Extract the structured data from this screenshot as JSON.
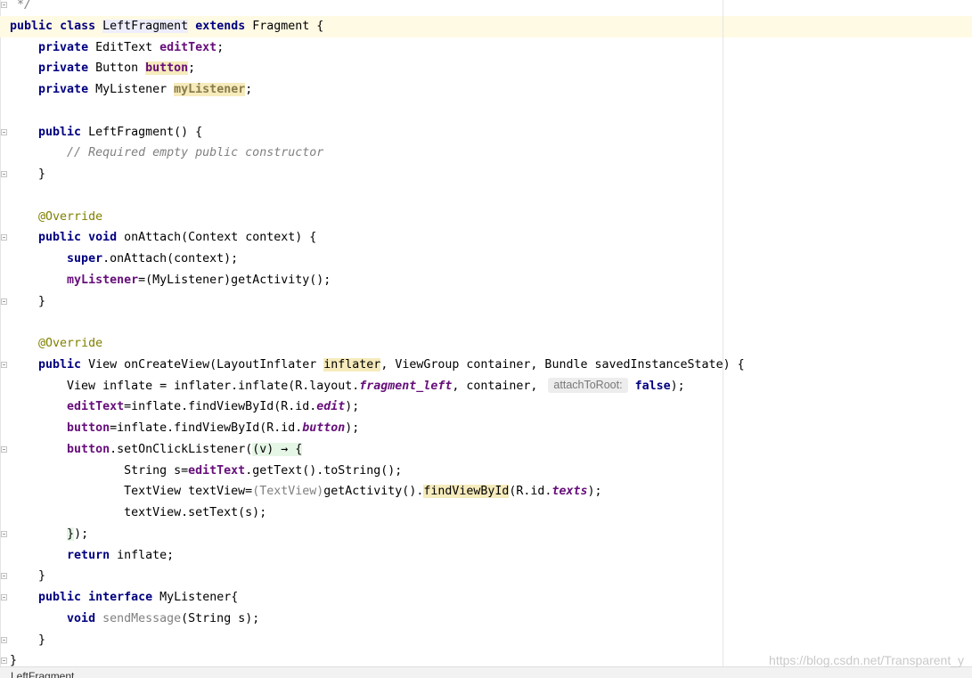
{
  "theme": {
    "keyword": "#000080",
    "field": "#660E7A",
    "unused_field": "#8A7B4A",
    "comment": "#808080",
    "annotation": "#808000",
    "unused": "#808080",
    "hint_text": "#787878",
    "hint_bg": "#EDEDED",
    "usage_bg": "#F6EBBC",
    "lambda_bg": "#E6F6E6",
    "ident_bg": "#EDEDFC",
    "current_line_bg": "#FFFAE3"
  },
  "editor": {
    "current_line": 1,
    "lines": [
      {
        "fold": "close",
        "tokens": [
          {
            "t": " */",
            "k": "cmt"
          }
        ]
      },
      {
        "tokens": [
          {
            "t": "public",
            "k": "kw"
          },
          {
            "t": " "
          },
          {
            "t": "class",
            "k": "kw"
          },
          {
            "t": " "
          },
          {
            "t": "LeftFragment",
            "bg": "ident"
          },
          {
            "t": " "
          },
          {
            "t": "extends",
            "k": "kw"
          },
          {
            "t": " Fragment {"
          }
        ]
      },
      {
        "tokens": [
          {
            "t": "    "
          },
          {
            "t": "private",
            "k": "kw"
          },
          {
            "t": " EditText "
          },
          {
            "t": "editText",
            "k": "fld"
          },
          {
            "t": ";"
          }
        ]
      },
      {
        "tokens": [
          {
            "t": "    "
          },
          {
            "t": "private",
            "k": "kw"
          },
          {
            "t": " Button "
          },
          {
            "t": "button",
            "k": "fld",
            "bg": "usage"
          },
          {
            "t": ";"
          }
        ]
      },
      {
        "tokens": [
          {
            "t": "    "
          },
          {
            "t": "private",
            "k": "kw"
          },
          {
            "t": " MyListener "
          },
          {
            "t": "myListener",
            "k": "fldw",
            "bg": "usage"
          },
          {
            "t": ";"
          }
        ]
      },
      {
        "tokens": []
      },
      {
        "fold": "open",
        "tokens": [
          {
            "t": "    "
          },
          {
            "t": "public",
            "k": "kw"
          },
          {
            "t": " LeftFragment() {"
          }
        ]
      },
      {
        "tokens": [
          {
            "t": "        "
          },
          {
            "t": "// Required empty public constructor",
            "k": "cmt"
          }
        ]
      },
      {
        "fold": "close",
        "tokens": [
          {
            "t": "    }"
          }
        ]
      },
      {
        "tokens": []
      },
      {
        "tokens": [
          {
            "t": "    "
          },
          {
            "t": "@Override",
            "k": "ann"
          }
        ]
      },
      {
        "fold": "open",
        "tokens": [
          {
            "t": "    "
          },
          {
            "t": "public",
            "k": "kw"
          },
          {
            "t": " "
          },
          {
            "t": "void",
            "k": "kw"
          },
          {
            "t": " onAttach(Context context) {"
          }
        ]
      },
      {
        "tokens": [
          {
            "t": "        "
          },
          {
            "t": "super",
            "k": "kw"
          },
          {
            "t": ".onAttach(context);"
          }
        ]
      },
      {
        "tokens": [
          {
            "t": "        "
          },
          {
            "t": "myListener",
            "k": "fld"
          },
          {
            "t": "=(MyListener)getActivity();"
          }
        ]
      },
      {
        "fold": "close",
        "tokens": [
          {
            "t": "    }"
          }
        ]
      },
      {
        "tokens": []
      },
      {
        "tokens": [
          {
            "t": "    "
          },
          {
            "t": "@Override",
            "k": "ann"
          }
        ]
      },
      {
        "fold": "open",
        "tokens": [
          {
            "t": "    "
          },
          {
            "t": "public",
            "k": "kw"
          },
          {
            "t": " View onCreateView(LayoutInflater "
          },
          {
            "t": "inflater",
            "bg": "usage"
          },
          {
            "t": ", ViewGroup container, Bundle savedInstanceState) {"
          }
        ]
      },
      {
        "tokens": [
          {
            "t": "        View inflate = inflater.inflate(R.layout."
          },
          {
            "t": "fragment_left",
            "k": "sfld"
          },
          {
            "t": ", container, "
          },
          {
            "t": "attachToRoot:",
            "k": "hint"
          },
          {
            "t": " "
          },
          {
            "t": "false",
            "k": "kw"
          },
          {
            "t": ");"
          }
        ]
      },
      {
        "tokens": [
          {
            "t": "        "
          },
          {
            "t": "editText",
            "k": "fld"
          },
          {
            "t": "=inflate.findViewById(R.id."
          },
          {
            "t": "edit",
            "k": "sfld"
          },
          {
            "t": ");"
          }
        ]
      },
      {
        "tokens": [
          {
            "t": "        "
          },
          {
            "t": "button",
            "k": "fld"
          },
          {
            "t": "=inflate.findViewById(R.id."
          },
          {
            "t": "button",
            "k": "sfld"
          },
          {
            "t": ");"
          }
        ]
      },
      {
        "fold": "open",
        "tokens": [
          {
            "t": "        "
          },
          {
            "t": "button",
            "k": "fld"
          },
          {
            "t": ".setOnClickListener("
          },
          {
            "t": "(v) → {",
            "bg": "lambda"
          }
        ]
      },
      {
        "tokens": [
          {
            "t": "                String s="
          },
          {
            "t": "editText",
            "k": "fld"
          },
          {
            "t": ".getText().toString();"
          }
        ]
      },
      {
        "tokens": [
          {
            "t": "                TextView textView="
          },
          {
            "t": "(TextView)",
            "k": "dim"
          },
          {
            "t": "getActivity()."
          },
          {
            "t": "findViewById",
            "bg": "usage"
          },
          {
            "t": "(R.id."
          },
          {
            "t": "texts",
            "k": "sfld"
          },
          {
            "t": ");"
          }
        ]
      },
      {
        "tokens": [
          {
            "t": "                textView.setText(s);"
          }
        ]
      },
      {
        "fold": "close",
        "tokens": [
          {
            "t": "        "
          },
          {
            "t": "}",
            "bg": "lambda"
          },
          {
            "t": ");"
          }
        ]
      },
      {
        "tokens": [
          {
            "t": "        "
          },
          {
            "t": "return",
            "k": "kw"
          },
          {
            "t": " inflate;"
          }
        ]
      },
      {
        "fold": "close",
        "tokens": [
          {
            "t": "    }"
          }
        ]
      },
      {
        "fold": "open",
        "tokens": [
          {
            "t": "    "
          },
          {
            "t": "public",
            "k": "kw"
          },
          {
            "t": " "
          },
          {
            "t": "interface",
            "k": "kw"
          },
          {
            "t": " MyListener{"
          }
        ]
      },
      {
        "tokens": [
          {
            "t": "        "
          },
          {
            "t": "void",
            "k": "kw"
          },
          {
            "t": " "
          },
          {
            "t": "sendMessage",
            "k": "dim"
          },
          {
            "t": "(String s);"
          }
        ]
      },
      {
        "fold": "close",
        "tokens": [
          {
            "t": "    }"
          }
        ]
      },
      {
        "fold": "close",
        "tokens": [
          {
            "t": "}"
          }
        ]
      }
    ]
  },
  "breadcrumb": {
    "item": "LeftFragment"
  },
  "watermark": "https://blog.csdn.net/Transparent_y"
}
